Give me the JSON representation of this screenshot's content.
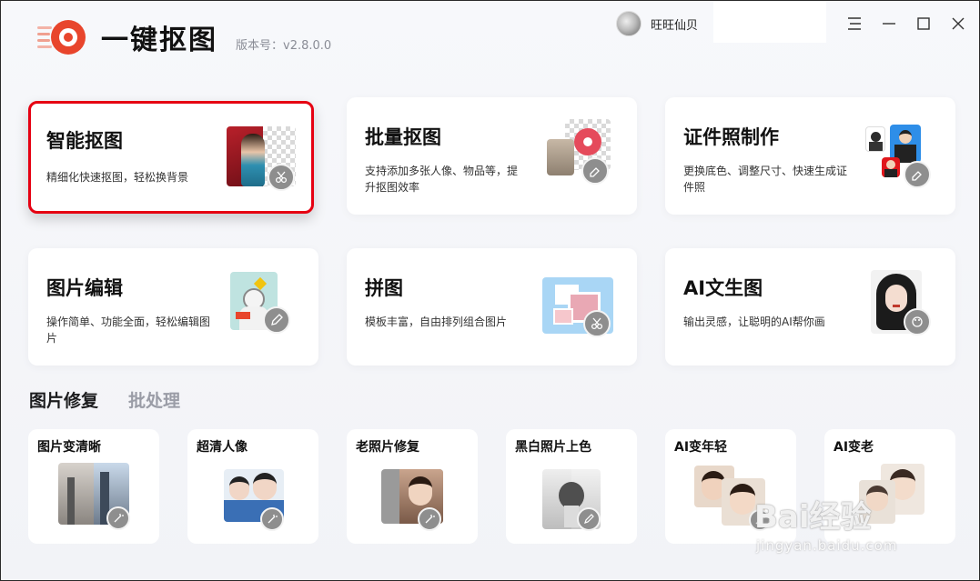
{
  "app": {
    "title": "一键抠图",
    "version": "版本号：v2.8.0.0",
    "brand_color": "#e8452c"
  },
  "user": {
    "name": "旺旺仙贝"
  },
  "window_controls": [
    "menu-icon",
    "minimize-icon",
    "maximize-icon",
    "close-icon"
  ],
  "main_features": [
    {
      "title": "智能抠图",
      "desc": "精细化快速抠图，轻松换背景",
      "selected": true
    },
    {
      "title": "批量抠图",
      "desc": "支持添加多张人像、物品等，提升抠图效率"
    },
    {
      "title": "证件照制作",
      "desc": "更换底色、调整尺寸、快速生成证件照"
    },
    {
      "title": "图片编辑",
      "desc": "操作简单、功能全面，轻松编辑图片"
    },
    {
      "title": "拼图",
      "desc": "模板丰富，自由排列组合图片"
    },
    {
      "title": "AI文生图",
      "desc": "输出灵感，让聪明的AI帮你画"
    }
  ],
  "tabs": [
    {
      "label": "图片修复",
      "active": true
    },
    {
      "label": "批处理",
      "active": false
    }
  ],
  "repair_tools": [
    {
      "title": "图片变清晰"
    },
    {
      "title": "超清人像"
    },
    {
      "title": "老照片修复"
    },
    {
      "title": "黑白照片上色"
    },
    {
      "title": "AI变年轻"
    },
    {
      "title": "AI变老"
    }
  ],
  "watermark": {
    "brand": "Bai经验",
    "url": "jingyan.baidu.com"
  }
}
